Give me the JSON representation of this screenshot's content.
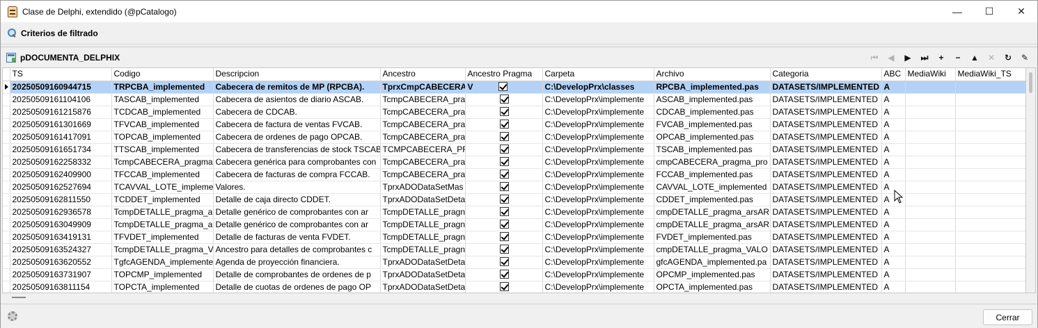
{
  "window": {
    "title": "Clase de Delphi, extendido (@pCatalogo)",
    "controls": [
      "—",
      "☐",
      "✕"
    ]
  },
  "filter": {
    "label": "Criterios de filtrado"
  },
  "grid": {
    "title": "pDOCUMENTA_DELPHIX",
    "nav": [
      {
        "name": "first-record-button",
        "glyph": "⏮",
        "enabled": false
      },
      {
        "name": "prior-record-button",
        "glyph": "◀",
        "enabled": false
      },
      {
        "name": "next-record-button",
        "glyph": "▶",
        "enabled": true
      },
      {
        "name": "last-record-button",
        "glyph": "⏭",
        "enabled": true
      },
      {
        "name": "insert-record-button",
        "glyph": "+",
        "enabled": true
      },
      {
        "name": "delete-record-button",
        "glyph": "−",
        "enabled": true
      },
      {
        "name": "edit-record-button",
        "glyph": "▲",
        "enabled": true
      },
      {
        "name": "cancel-edit-button",
        "glyph": "✕",
        "enabled": false
      },
      {
        "name": "refresh-button",
        "glyph": "↻",
        "enabled": true
      },
      {
        "name": "apply-updates-button",
        "glyph": "✎",
        "enabled": true
      }
    ],
    "columns": [
      "TS",
      "Codigo",
      "Descripcion",
      "Ancestro",
      "Ancestro Pragma",
      "Carpeta",
      "Archivo",
      "Categoria",
      "ABC",
      "MediaWiki",
      "MediaWiki_TS"
    ],
    "rows": [
      [
        "20250509160944715",
        "TRPCBA_implemented",
        "Cabecera de remitos de MP (RPCBA).",
        "TprxCmpCABECERA",
        "V",
        "C:\\DevelopPrx\\classes",
        "RPCBA_implemented.pas",
        "DATASETS/IMPLEMENTED",
        "A",
        "",
        ""
      ],
      [
        "20250509161104106",
        "TASCAB_implemented",
        "Cabecera de asientos de diario ASCAB.",
        "TcmpCABECERA_pra",
        "",
        "C:\\DevelopPrx\\implemente",
        "ASCAB_implemented.pas",
        "DATASETS/IMPLEMENTED",
        "A",
        "",
        ""
      ],
      [
        "20250509161215876",
        "TCDCAB_implemented",
        "Cabecera de CDCAB.",
        "TcmpCABECERA_pra",
        "",
        "C:\\DevelopPrx\\implemente",
        "CDCAB_implemented.pas",
        "DATASETS/IMPLEMENTED",
        "A",
        "",
        ""
      ],
      [
        "20250509161301669",
        "TFVCAB_implemented",
        "Cabecera de factura de ventas FVCAB.",
        "TcmpCABECERA_pra",
        "",
        "C:\\DevelopPrx\\implemente",
        "FVCAB_implemented.pas",
        "DATASETS/IMPLEMENTED",
        "A",
        "",
        ""
      ],
      [
        "20250509161417091",
        "TOPCAB_implemented",
        "Cabecera de ordenes de pago OPCAB.",
        "TcmpCABECERA_pra",
        "",
        "C:\\DevelopPrx\\implemente",
        "OPCAB_implemented.pas",
        "DATASETS/IMPLEMENTED",
        "A",
        "",
        ""
      ],
      [
        "20250509161651734",
        "TTSCAB_implemented",
        "Cabecera de transferencias de stock TSCAB",
        "TCMPCABECERA_PRA",
        "",
        "C:\\DevelopPrx\\implemente",
        "TSCAB_implemented.pas",
        "DATASETS/IMPLEMENTED",
        "A",
        "",
        ""
      ],
      [
        "20250509162258332",
        "TcmpCABECERA_pragma",
        "Cabecera genérica para comprobantes con",
        "TcmpCABECERA_pra",
        "",
        "C:\\DevelopPrx\\implemente",
        "cmpCABECERA_pragma_pro",
        "DATASETS/IMPLEMENTED",
        "A",
        "",
        ""
      ],
      [
        "20250509162409900",
        "TFCCAB_implemented",
        "Cabecera de facturas de compra FCCAB.",
        "TcmpCABECERA_pra",
        "",
        "C:\\DevelopPrx\\implemente",
        "FCCAB_implemented.pas",
        "DATASETS/IMPLEMENTED",
        "A",
        "",
        ""
      ],
      [
        "20250509162527694",
        "TCAVVAL_LOTE_impleme",
        "Valores.",
        "TprxADODataSetMas",
        "",
        "C:\\DevelopPrx\\implemente",
        "CAVVAL_LOTE_implemented",
        "DATASETS/IMPLEMENTED",
        "A",
        "",
        ""
      ],
      [
        "20250509162811550",
        "TCDDET_implemented",
        "Detalle de caja directo CDDET.",
        "TprxADODataSetDeta",
        "",
        "C:\\DevelopPrx\\implemente",
        "CDDET_implemented.pas",
        "DATASETS/IMPLEMENTED",
        "A",
        "",
        ""
      ],
      [
        "20250509162936578",
        "TcmpDETALLE_pragma_a",
        "Detalle genérico de comprobantes con ar",
        "TcmpDETALLE_pragn",
        "",
        "C:\\DevelopPrx\\implemente",
        "cmpDETALLE_pragma_arsAR",
        "DATASETS/IMPLEMENTED",
        "A",
        "",
        ""
      ],
      [
        "20250509163049909",
        "TcmpDETALLE_pragma_a",
        "Detalle genérico de comprobantes con ar",
        "TcmpDETALLE_pragn",
        "",
        "C:\\DevelopPrx\\implemente",
        "cmpDETALLE_pragma_arsAR",
        "DATASETS/IMPLEMENTED",
        "A",
        "",
        ""
      ],
      [
        "20250509163419131",
        "TFVDET_implemented",
        "Detalle de facturas de venta FVDET.",
        "TcmpDETALLE_pragn",
        "",
        "C:\\DevelopPrx\\implemente",
        "FVDET_implemented.pas",
        "DATASETS/IMPLEMENTED",
        "A",
        "",
        ""
      ],
      [
        "20250509163524327",
        "TcmpDETALLE_pragma_V",
        "Ancestro para detalles de comprobantes c",
        "TcmpDETALLE_pragn",
        "",
        "C:\\DevelopPrx\\implemente",
        "cmpDETALLE_pragma_VALO",
        "DATASETS/IMPLEMENTED",
        "A",
        "",
        ""
      ],
      [
        "20250509163620552",
        "TgfcAGENDA_implemente",
        "Agenda de proyección financiera.",
        "TprxADODataSetDeta",
        "",
        "C:\\DevelopPrx\\implemente",
        "gfcAGENDA_implemented.pa",
        "DATASETS/IMPLEMENTED",
        "A",
        "",
        ""
      ],
      [
        "20250509163731907",
        "TOPCMP_implemented",
        "Detalle de comprobantes de ordenes de p",
        "TprxADODataSetDeta",
        "",
        "C:\\DevelopPrx\\implemente",
        "OPCMP_implemented.pas",
        "DATASETS/IMPLEMENTED",
        "A",
        "",
        ""
      ],
      [
        "20250509163811154",
        "TOPCTA_implemented",
        "Detalle de cuotas de ordenes de pago OP",
        "TprxADODataSetDeta",
        "",
        "C:\\DevelopPrx\\implemente",
        "OPCTA_implemented.pas",
        "DATASETS/IMPLEMENTED",
        "A",
        "",
        ""
      ]
    ],
    "selected_row": 0
  },
  "footer": {
    "close_label": "Cerrar"
  },
  "colors": {
    "selection": "#b4d2f6",
    "window_bg": "#f0f0f0"
  }
}
